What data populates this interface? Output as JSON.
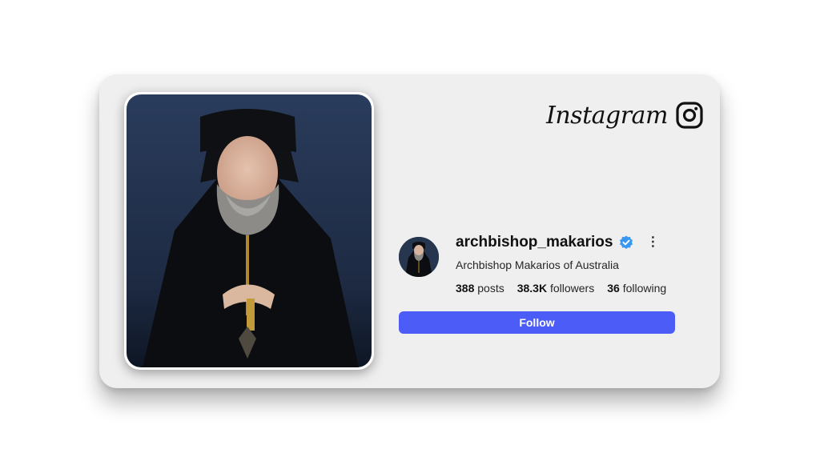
{
  "brand": {
    "wordmark": "Instagram",
    "icon": "instagram-icon"
  },
  "profile": {
    "username": "archbishop_makarios",
    "verified_icon": "verified-badge-icon",
    "more_icon": "more-options-icon",
    "more_symbol": "⋮",
    "full_name": "Archbishop Makarios of Australia",
    "stats": {
      "posts_count": "388",
      "posts_label": "posts",
      "followers_count": "38.3K",
      "followers_label": "followers",
      "following_count": "36",
      "following_label": "following"
    },
    "follow_label": "Follow"
  },
  "colors": {
    "card_background": "#efefef",
    "follow_button": "#4c5cf6",
    "verified_badge": "#3897f0",
    "photo_background": "#233454"
  }
}
